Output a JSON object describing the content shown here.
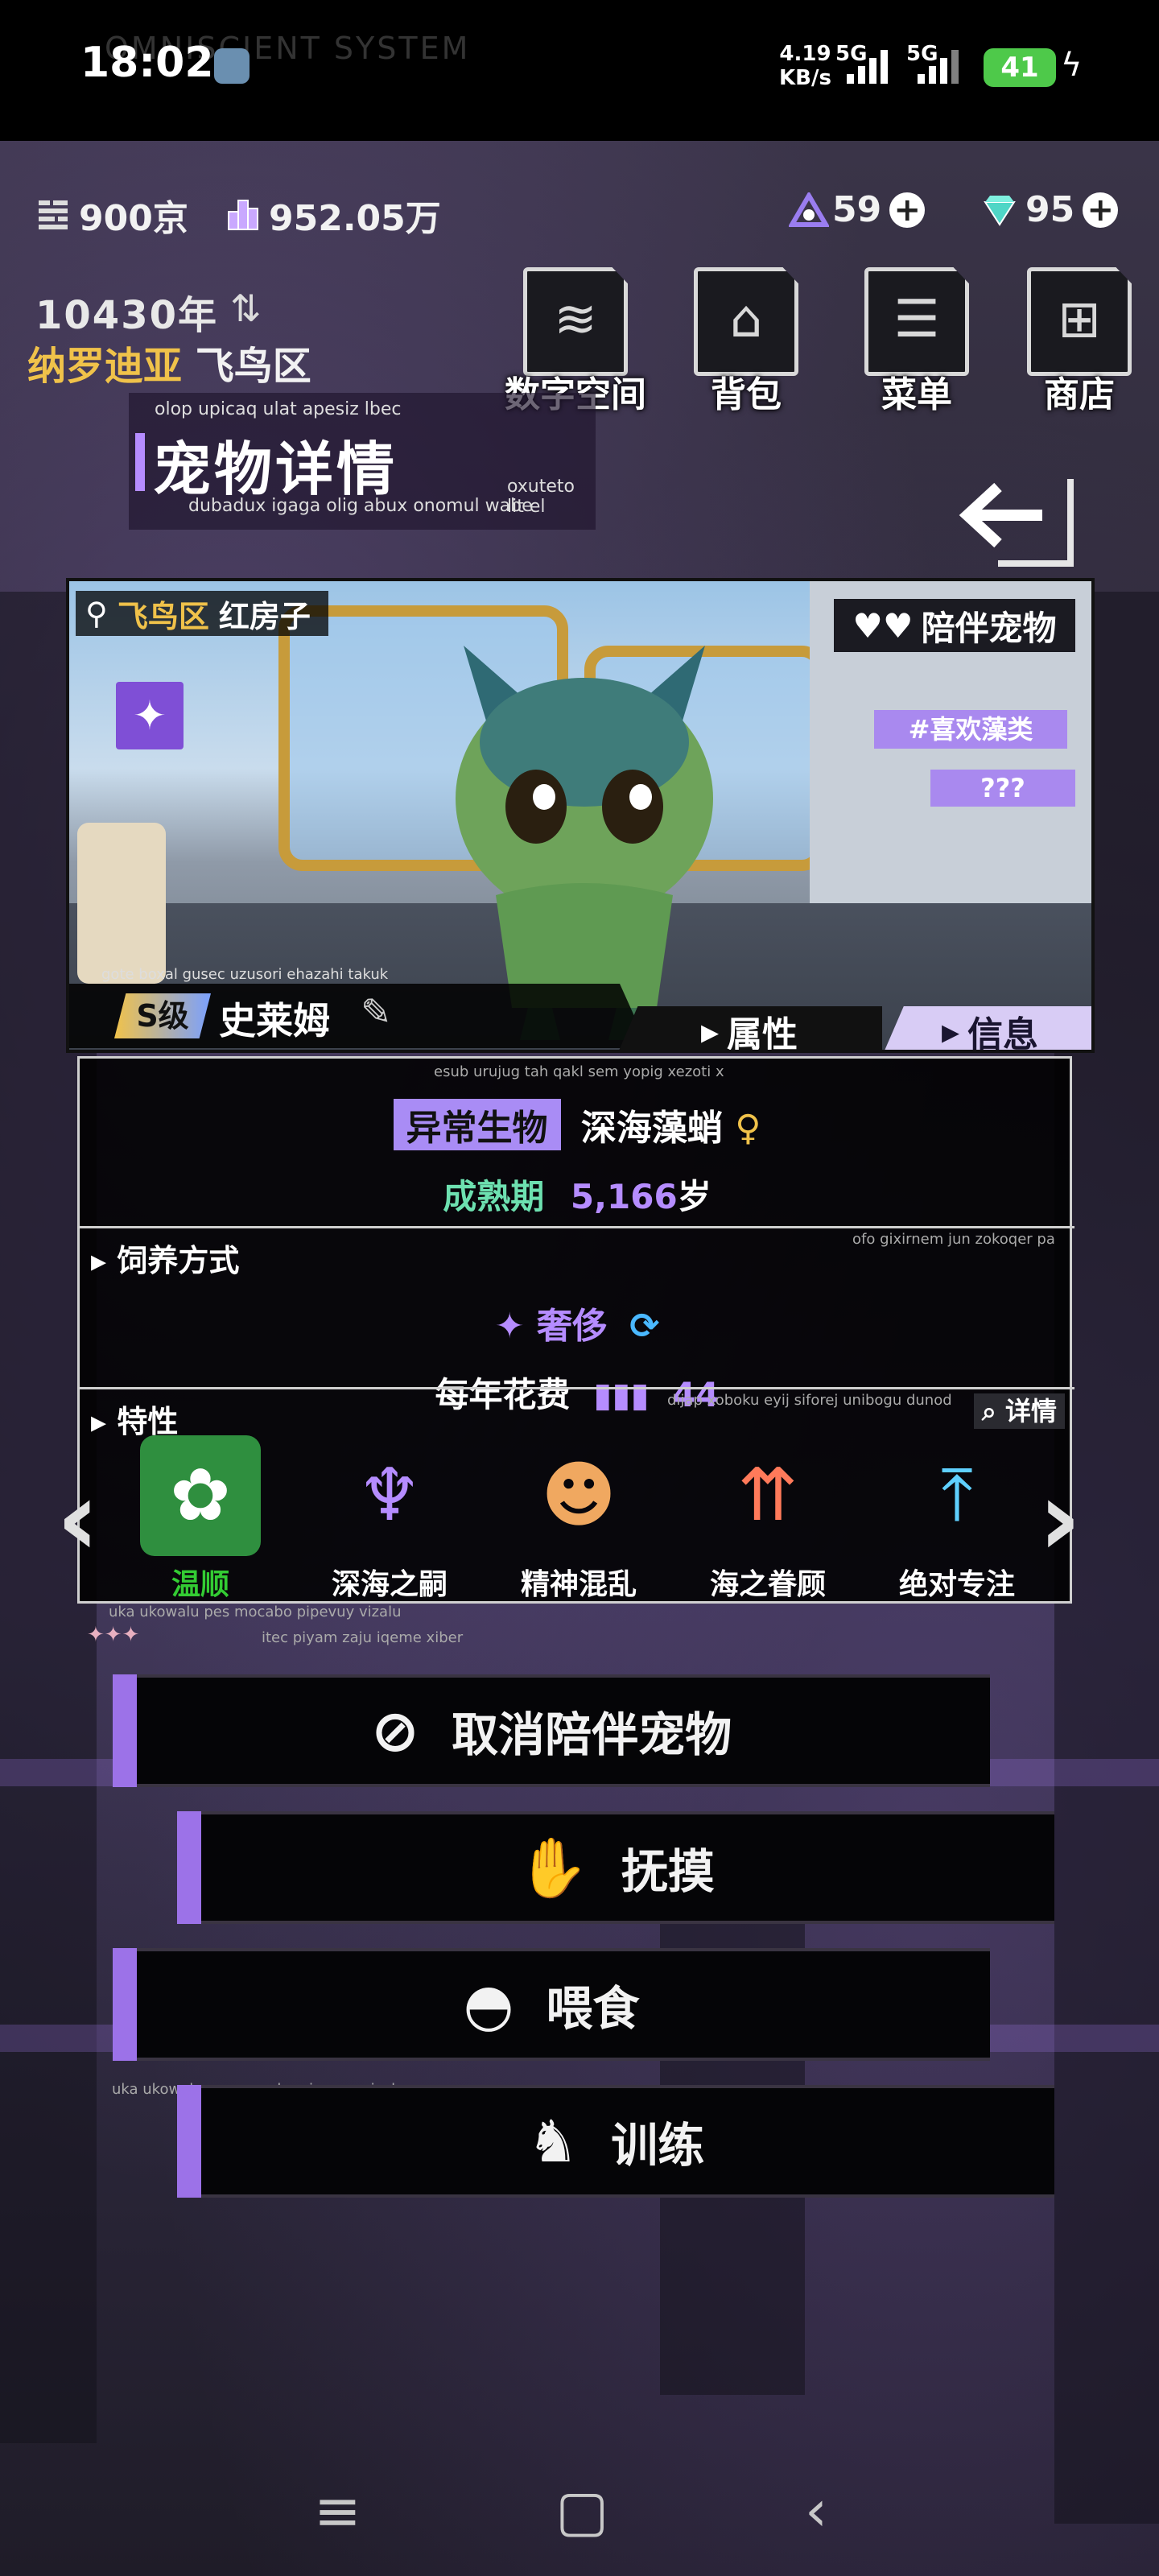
{
  "status_bar": {
    "time": "18:02",
    "watermark": "OMNISCIENT SYSTEM",
    "net_speed": "4.19",
    "net_unit": "KB/s",
    "sig1": "5G",
    "sig2": "5G",
    "battery": "41"
  },
  "currency": {
    "chips": "900京",
    "cubes": "952.05万",
    "tokens": "59",
    "gems": "95"
  },
  "header": {
    "year": "10430年",
    "region_gold": "纳罗迪亚",
    "region_white": "飞鸟区"
  },
  "nav": [
    {
      "label": "数字空间",
      "icon": "layers-icon"
    },
    {
      "label": "背包",
      "icon": "bag-icon"
    },
    {
      "label": "菜单",
      "icon": "menu-icon"
    },
    {
      "label": "商店",
      "icon": "cart-icon"
    }
  ],
  "title": {
    "main": "宠物详情",
    "small": "olop upicaq ulat apesiz lbec",
    "sub": "dubadux igaga olig abux onomul wabe",
    "sub2": "oxuteto lit el"
  },
  "pet": {
    "location_district": "飞鸟区",
    "location_place": "红房子",
    "companion_tag": "陪伴宠物",
    "hash_tag": "#喜欢藻类",
    "unknown_tag": "???",
    "grade": "S级",
    "name": "史莱姆",
    "scene_caption": "gote boxal gusec uzusori ehazahi takuk",
    "tabs": {
      "attr": "属性",
      "info": "信息"
    }
  },
  "info": {
    "tiny_top": "esub urujug tah qakl sem yopig xezoti x",
    "species_badge": "异常生物",
    "species": "深海藻蛸",
    "stage": "成熟期",
    "age": "5,166",
    "age_unit": "岁",
    "feeding_label": "饲养方式",
    "feeding_tiny": "ofo gixirnem jun zokoqer pa",
    "feeding_mode": "奢侈",
    "cost_label": "每年花费",
    "cost_value": "44",
    "traits_label": "特性",
    "traits_tiny": "dijap xoboku eyij siforej unibogu dunod",
    "detail_btn": "详情",
    "traits": [
      {
        "name": "温顺",
        "icon": "cotton-flower-icon"
      },
      {
        "name": "深海之嗣",
        "icon": "octopus-icon"
      },
      {
        "name": "精神混乱",
        "icon": "head-chaos-icon"
      },
      {
        "name": "海之眷顾",
        "icon": "up-arrows-icon"
      },
      {
        "name": "绝对专注",
        "icon": "focus-arrows-icon"
      }
    ],
    "tiny_bottom1": "uka ukowalu pes mocabo pipevuy vizalu",
    "tiny_bottom2": "itec piyam zaju iqeme xiber"
  },
  "actions": [
    {
      "label": "取消陪伴宠物",
      "icon": "cancel-pet-icon"
    },
    {
      "label": "抚摸",
      "icon": "pet-hand-icon"
    },
    {
      "label": "喂食",
      "icon": "food-bowl-icon"
    },
    {
      "label": "训练",
      "icon": "train-dog-icon"
    }
  ],
  "colors": {
    "accent": "#9c72e8",
    "gold": "#f0c24a",
    "green": "#6de0b0"
  }
}
